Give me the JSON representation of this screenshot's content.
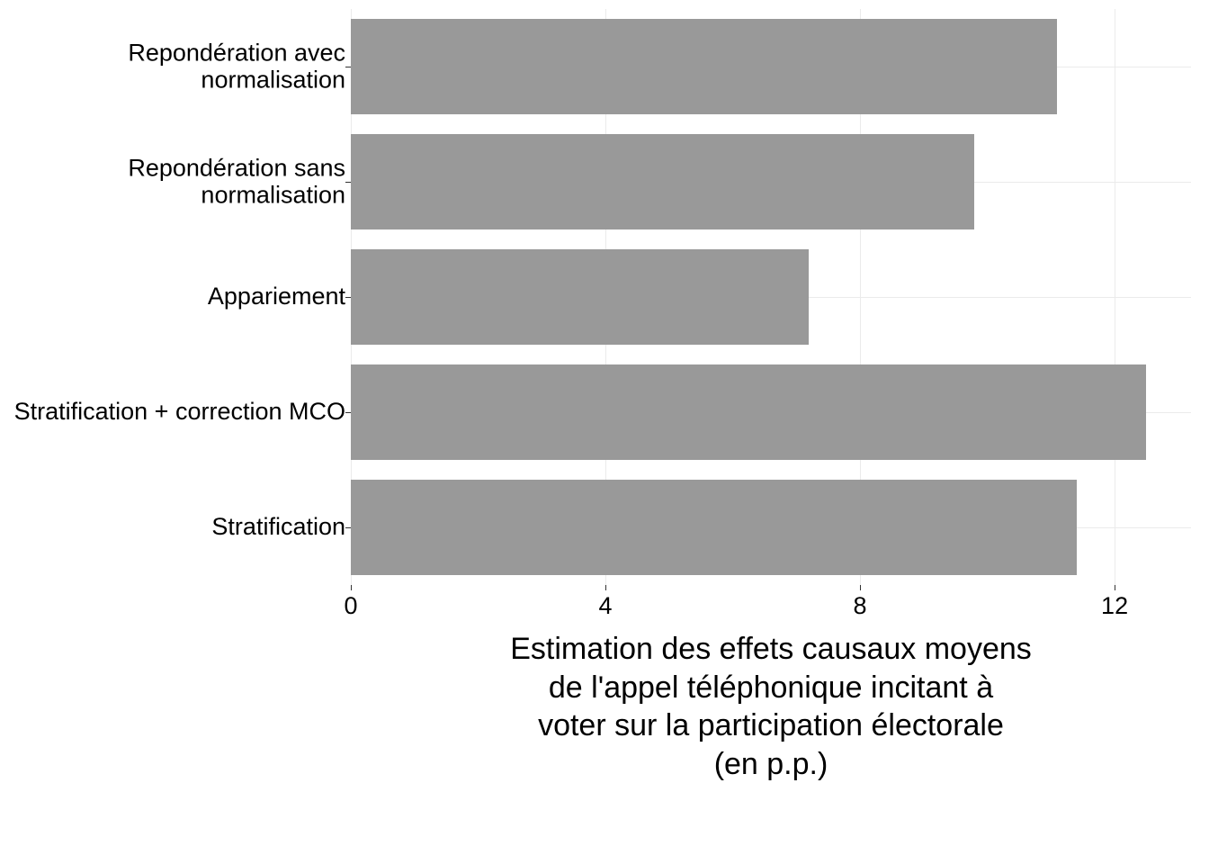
{
  "chart_data": {
    "type": "bar",
    "orientation": "horizontal",
    "categories": [
      "Repondération avec normalisation",
      "Repondération sans normalisation",
      "Appariement",
      "Stratification + correction MCO",
      "Stratification"
    ],
    "values": [
      11.1,
      9.8,
      7.2,
      12.5,
      11.4
    ],
    "xlim": [
      0,
      13.2
    ],
    "x_ticks": [
      0,
      4,
      8,
      12
    ],
    "xlabel_line1": "Estimation des effets causaux moyens",
    "xlabel_line2": "de l'appel téléphonique incitant à",
    "xlabel_line3": "voter sur la participation électorale",
    "xlabel_line4": "(en p.p.)",
    "ylabel": "",
    "title": "",
    "bar_color": "#999999",
    "grid_color": "#ebebeb"
  },
  "x_tick_labels": {
    "t0": "0",
    "t1": "4",
    "t2": "8",
    "t3": "12"
  }
}
